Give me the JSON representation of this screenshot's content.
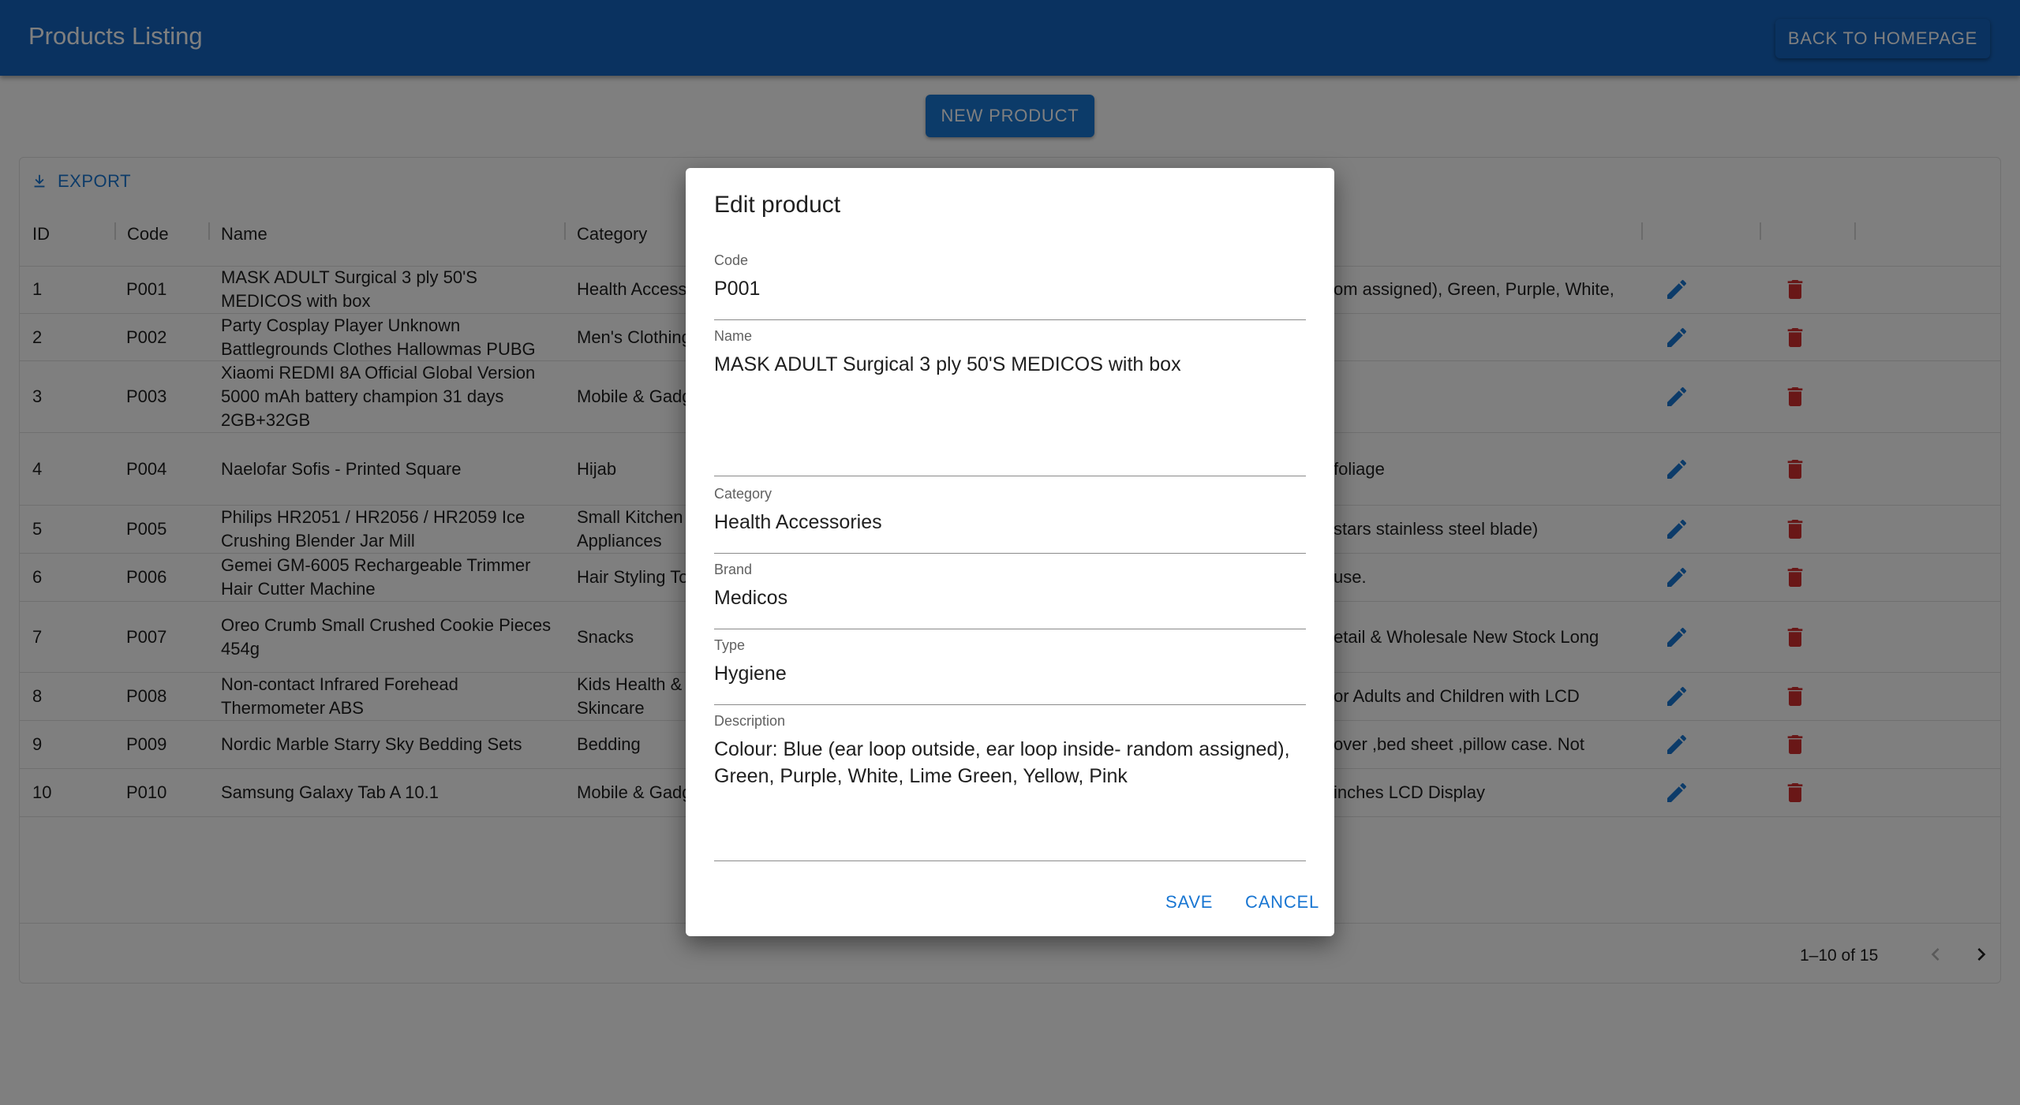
{
  "appbar": {
    "title": "Products Listing",
    "back_label": "BACK TO HOMEPAGE"
  },
  "toolbar": {
    "new_product_label": "NEW PRODUCT",
    "export_label": "EXPORT"
  },
  "table": {
    "columns": [
      "ID",
      "Code",
      "Name",
      "Category"
    ],
    "rows": [
      {
        "id": "1",
        "code": "P001",
        "name": "MASK ADULT Surgical 3 ply 50'S MEDICOS with box",
        "category": "Health Accesso",
        "extra": "om assigned), Green, Purple, White,"
      },
      {
        "id": "2",
        "code": "P002",
        "name": "Party Cosplay Player Unknown Battlegrounds Clothes Hallowmas PUBG",
        "category": "Men's Clothing",
        "extra": ""
      },
      {
        "id": "3",
        "code": "P003",
        "name": "Xiaomi REDMI 8A Official Global Version 5000 mAh battery champion 31 days 2GB+32GB",
        "category": "Mobile & Gadg",
        "extra": ""
      },
      {
        "id": "4",
        "code": "P004",
        "name": "Naelofar Sofis - Printed Square",
        "category": "Hijab",
        "extra": "foliage"
      },
      {
        "id": "5",
        "code": "P005",
        "name": "Philips HR2051 / HR2056 / HR2059 Ice Crushing Blender Jar Mill",
        "category": "Small Kitchen Appliances",
        "extra": "stars stainless steel blade)"
      },
      {
        "id": "6",
        "code": "P006",
        "name": "Gemei GM-6005 Rechargeable Trimmer Hair Cutter Machine",
        "category": "Hair Styling To",
        "extra": "use."
      },
      {
        "id": "7",
        "code": "P007",
        "name": "Oreo Crumb Small Crushed Cookie Pieces 454g",
        "category": "Snacks",
        "extra": "etail & Wholesale New Stock Long"
      },
      {
        "id": "8",
        "code": "P008",
        "name": "Non-contact Infrared Forehead Thermometer ABS",
        "category": "Kids Health & Skincare",
        "extra": "or Adults and Children with LCD"
      },
      {
        "id": "9",
        "code": "P009",
        "name": "Nordic Marble Starry Sky Bedding Sets",
        "category": "Bedding",
        "extra": "over ,bed sheet ,pillow case. Not"
      },
      {
        "id": "10",
        "code": "P010",
        "name": "Samsung Galaxy Tab A 10.1",
        "category": "Mobile & Gadg",
        "extra": "inches LCD Display"
      }
    ]
  },
  "pagination": {
    "range_label": "1–10 of 15"
  },
  "dialog": {
    "title": "Edit product",
    "code_label": "Code",
    "code_value": "P001",
    "name_label": "Name",
    "name_value": "MASK ADULT Surgical 3 ply 50'S MEDICOS with box",
    "category_label": "Category",
    "category_value": "Health Accessories",
    "brand_label": "Brand",
    "brand_value": "Medicos",
    "type_label": "Type",
    "type_value": "Hygiene",
    "description_label": "Description",
    "description_value": "Colour: Blue (ear loop outside, ear loop inside- random assigned), Green, Purple, White, Lime Green, Yellow, Pink",
    "save_label": "SAVE",
    "cancel_label": "CANCEL"
  },
  "colors": {
    "primary": "#1565c0",
    "accent": "#1976d2",
    "danger": "#d32f2f"
  }
}
